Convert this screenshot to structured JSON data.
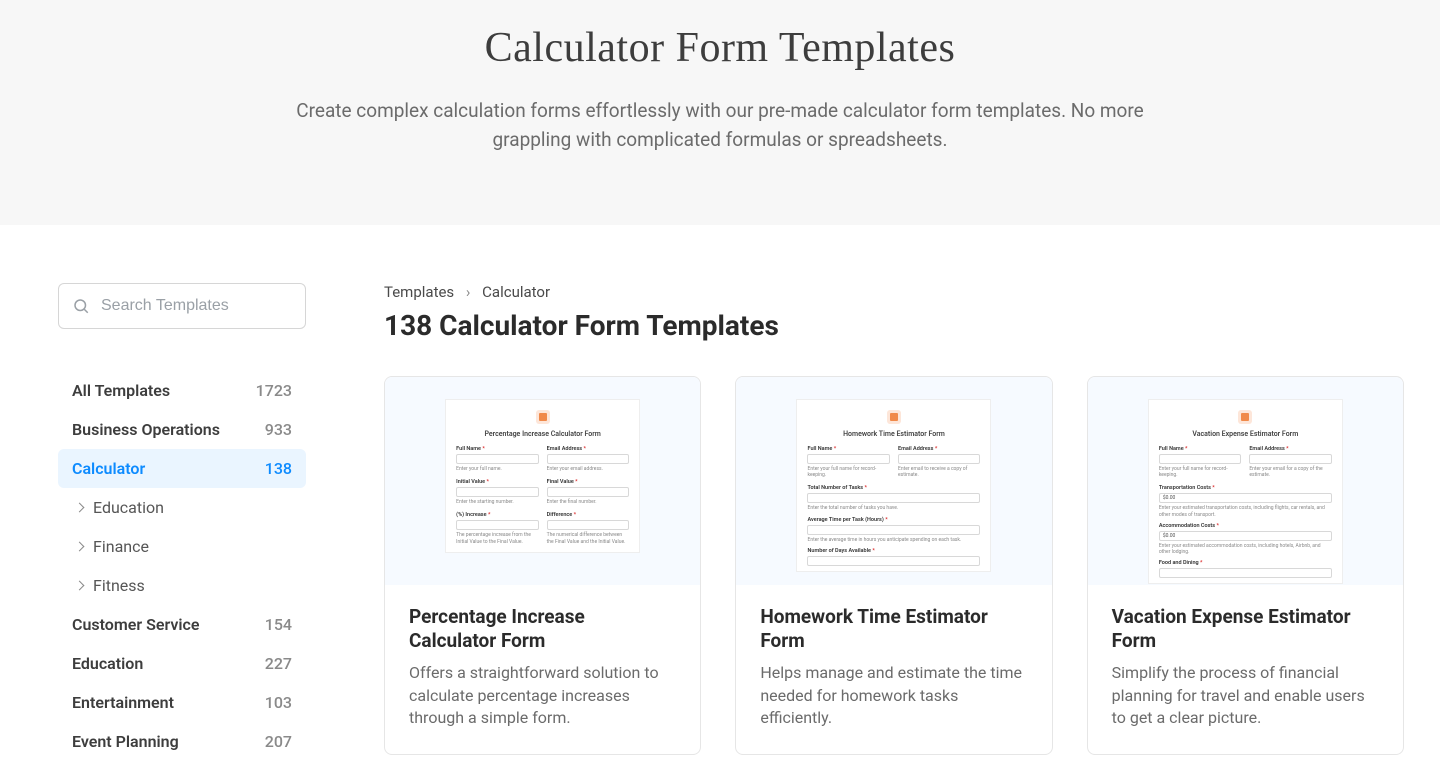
{
  "hero": {
    "title": "Calculator Form Templates",
    "subtitle": "Create complex calculation forms effortlessly with our pre-made calculator form templates. No more grappling with complicated formulas or spreadsheets."
  },
  "search": {
    "placeholder": "Search Templates"
  },
  "sidebar": {
    "items": [
      {
        "label": "All Templates",
        "count": "1723"
      },
      {
        "label": "Business Operations",
        "count": "933"
      },
      {
        "label": "Calculator",
        "count": "138",
        "active": true
      },
      {
        "label": "Customer Service",
        "count": "154"
      },
      {
        "label": "Education",
        "count": "227"
      },
      {
        "label": "Entertainment",
        "count": "103"
      },
      {
        "label": "Event Planning",
        "count": "207"
      }
    ],
    "subitems": [
      {
        "label": "Education"
      },
      {
        "label": "Finance"
      },
      {
        "label": "Fitness"
      }
    ]
  },
  "breadcrumb": {
    "root": "Templates",
    "current": "Calculator"
  },
  "heading": "138 Calculator Form Templates",
  "cards": [
    {
      "title": "Percentage Increase Calculator Form",
      "desc": "Offers a straightforward solution to calculate percentage increases through a simple form.",
      "preview": {
        "title": "Percentage Increase Calculator Form",
        "fields": [
          {
            "cols": [
              {
                "label": "Full Name",
                "hint": "Enter your full name."
              },
              {
                "label": "Email Address",
                "hint": "Enter your email address."
              }
            ]
          },
          {
            "cols": [
              {
                "label": "Initial Value",
                "hint": "Enter the starting number."
              },
              {
                "label": "Final Value",
                "hint": "Enter the final number."
              }
            ]
          },
          {
            "cols": [
              {
                "label": "(%) Increase",
                "hint": "The percentage increase from the Initial Value to the Final Value."
              },
              {
                "label": "Difference",
                "hint": "The numerical difference between the Final Value and the Initial Value."
              }
            ]
          }
        ]
      }
    },
    {
      "title": "Homework Time Estimator Form",
      "desc": "Helps manage and estimate the time needed for homework tasks efficiently.",
      "preview": {
        "title": "Homework Time Estimator Form",
        "fields": [
          {
            "cols": [
              {
                "label": "Full Name",
                "hint": "Enter your full name for record-keeping."
              },
              {
                "label": "Email Address",
                "hint": "Enter email to receive a copy of estimate."
              }
            ]
          },
          {
            "full": {
              "label": "Total Number of Tasks",
              "hint": "Enter the total number of tasks you have."
            }
          },
          {
            "full": {
              "label": "Average Time per Task (Hours)",
              "hint": "Enter the average time in hours you anticipate spending on each task."
            }
          },
          {
            "full": {
              "label": "Number of Days Available",
              "hint": ""
            }
          }
        ]
      }
    },
    {
      "title": "Vacation Expense Estimator Form",
      "desc": "Simplify the process of financial planning for travel and enable users to get a clear picture.",
      "preview": {
        "title": "Vacation Expense Estimator Form",
        "fields": [
          {
            "cols": [
              {
                "label": "Full Name",
                "hint": "Enter your full name for record-keeping."
              },
              {
                "label": "Email Address",
                "hint": "Enter your email for a copy of the estimate."
              }
            ]
          },
          {
            "full": {
              "label": "Transportation Costs",
              "value": "$0.00",
              "hint": "Enter your estimated transportation costs, including flights, car rentals, and other modes of transport."
            }
          },
          {
            "full": {
              "label": "Accommodation Costs",
              "value": "$0.00",
              "hint": "Enter your estimated accommodation costs, including hotels, Airbnb, and other lodging."
            }
          },
          {
            "full": {
              "label": "Food and Dining",
              "hint": ""
            }
          }
        ]
      }
    }
  ]
}
